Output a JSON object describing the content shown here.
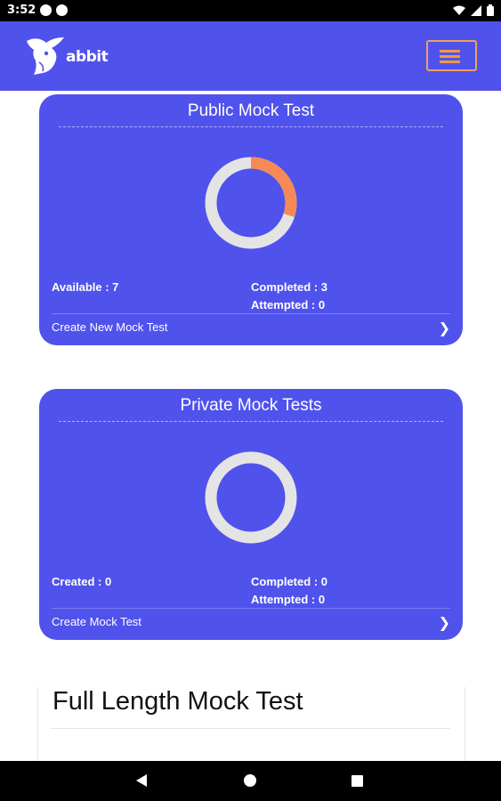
{
  "status_bar": {
    "time": "3:52"
  },
  "header": {
    "logo_text": "abbit"
  },
  "public_card": {
    "title": "Public Mock Test",
    "available": "Available : 7",
    "completed": "Completed : 3",
    "attempted": "Attempted : 0",
    "link": "Create New Mock Test",
    "completed_fraction": 0.3
  },
  "private_card": {
    "title": "Private Mock Tests",
    "created": "Created : 0",
    "completed": "Completed : 0",
    "attempted": "Attempted : 0",
    "link": "Create Mock Test",
    "completed_fraction": 0
  },
  "full_length": {
    "title": "Full Length Mock Test"
  },
  "colors": {
    "primary": "#5052ec",
    "accent": "#f58a57",
    "ring": "#e4e4e4"
  }
}
